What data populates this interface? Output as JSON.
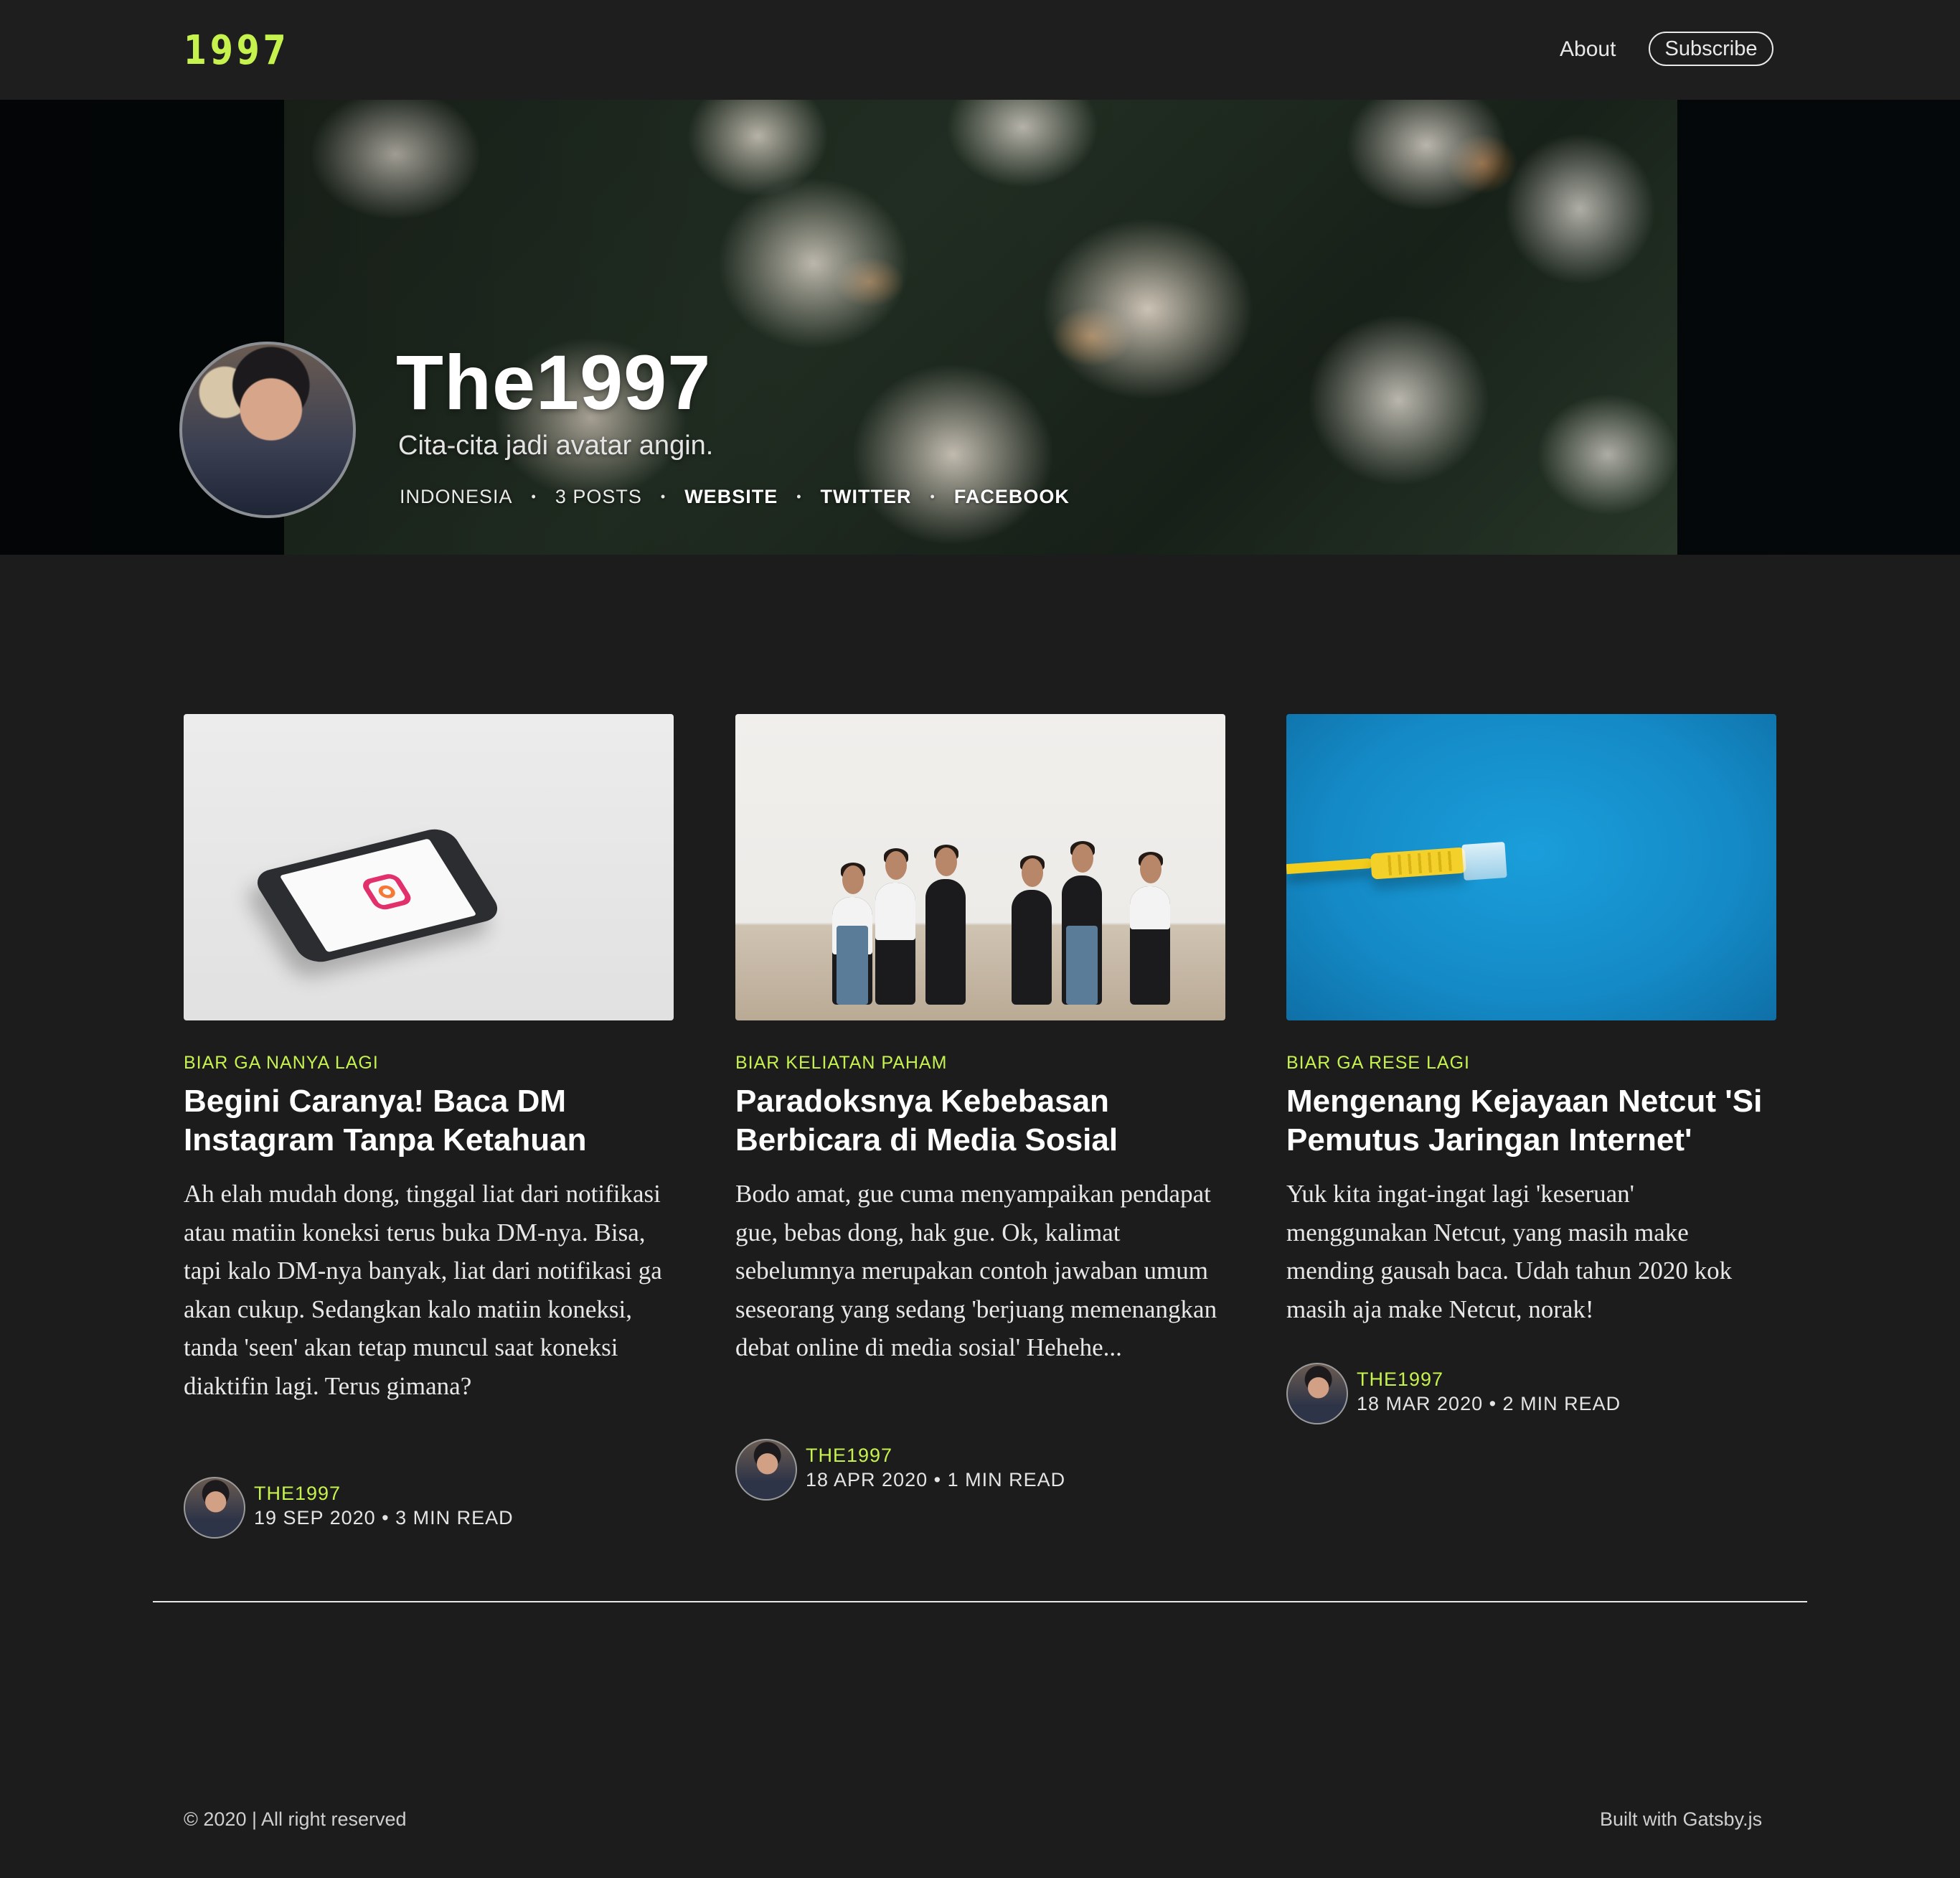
{
  "header": {
    "logo": "1997",
    "nav": {
      "about": "About",
      "subscribe": "Subscribe"
    }
  },
  "profile": {
    "name": "The1997",
    "bio": "Cita-cita jadi avatar angin.",
    "location": "INDONESIA",
    "post_count": "3 POSTS",
    "separator": "•",
    "links": {
      "website": "WEBSITE",
      "twitter": "TWITTER",
      "facebook": "FACEBOOK"
    }
  },
  "posts": [
    {
      "tag": "BIAR GA NANYA LAGI",
      "title": "Begini Caranya! Baca DM Instagram Tanpa Ketahuan",
      "excerpt": "Ah elah mudah dong, tinggal liat dari notifikasi atau matiin koneksi terus buka DM-nya. Bisa, tapi kalo DM-nya banyak, liat dari notifikasi ga akan cukup. Sedangkan kalo matiin koneksi, tanda 'seen' akan tetap muncul saat koneksi diaktifin lagi. Terus gimana?",
      "author": "THE1997",
      "meta": "19 SEP 2020 • 3 MIN READ",
      "image_icon": "instagram-phone-image"
    },
    {
      "tag": "BIAR KELIATAN PAHAM",
      "title": "Paradoksnya Kebebasan Berbicara di Media Sosial",
      "excerpt": "Bodo amat, gue cuma menyampaikan pendapat gue, bebas dong, hak gue. Ok, kalimat sebelumnya merupakan contoh jawaban umum seseorang yang sedang 'berjuang memenangkan debat online di media sosial' Hehehe...",
      "author": "THE1997",
      "meta": "18 APR 2020 • 1 MIN READ",
      "image_icon": "people-with-phones-image"
    },
    {
      "tag": "BIAR GA RESE LAGI",
      "title": "Mengenang Kejayaan Netcut 'Si Pemutus Jaringan Internet'",
      "excerpt": "Yuk kita ingat-ingat lagi 'keseruan' menggunakan Netcut, yang masih make mending gausah baca. Udah tahun 2020 kok masih aja make Netcut, norak!",
      "author": "THE1997",
      "meta": "18 MAR 2020 • 2 MIN READ",
      "image_icon": "ethernet-cable-image"
    }
  ],
  "footer": {
    "copyright": "© 2020 | All right reserved",
    "built_with": "Built with Gatsby.js"
  },
  "colors": {
    "accent": "#c6f24e",
    "background": "#1c1c1d",
    "header": "#1e1e1f",
    "text": "#ffffff"
  }
}
